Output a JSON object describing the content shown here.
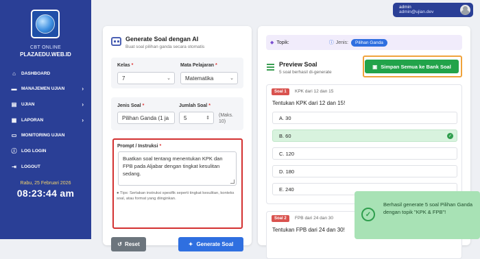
{
  "sidebar": {
    "brand_top": "CBT ONLINE",
    "brand_site": "PLAZAEDU.WEB.ID",
    "items": [
      {
        "label": "DASHBOARD",
        "icon": "home-icon",
        "has_submenu": false
      },
      {
        "label": "MANAJEMEN UJIAN",
        "icon": "folder-icon",
        "has_submenu": true
      },
      {
        "label": "UJIAN",
        "icon": "file-icon",
        "has_submenu": true
      },
      {
        "label": "LAPORAN",
        "icon": "report-icon",
        "has_submenu": true
      },
      {
        "label": "MONITORING UJIAN",
        "icon": "monitor-icon",
        "has_submenu": false
      },
      {
        "label": "LOG LOGIN",
        "icon": "info-icon",
        "has_submenu": false
      },
      {
        "label": "LOGOUT",
        "icon": "logout-icon",
        "has_submenu": false
      }
    ],
    "date": "Rabu, 25 Februari 2026",
    "time": "08:23:44 am"
  },
  "user": {
    "name": "admin",
    "email": "admin@ujian.dev"
  },
  "generator": {
    "title": "Generate Soal dengan AI",
    "subtitle": "Buat soal pilihan ganda secara otomatis",
    "kelas_label": "Kelas",
    "kelas_value": "7",
    "mapel_label": "Mata Pelajaran",
    "mapel_value": "Matematika",
    "jenis_label": "Jenis Soal",
    "jenis_value": "Pilihan Ganda (1 ja",
    "jumlah_label": "Jumlah Soal",
    "jumlah_value": "5",
    "jumlah_note": "(Maks. 10)",
    "prompt_label": "Prompt / Instruksi",
    "prompt_value": "Buatkan soal tentang menentukan KPK dan FPB pada Aljabar dengan tingkat kesulitan sedang.",
    "tips": "Tips: Sertakan instruksi spesifik seperti tingkat kesulitan, konteks soal, atau format yang diinginkan.",
    "reset_label": "Reset",
    "generate_label": "Generate Soal",
    "required_mark": "*"
  },
  "preview": {
    "topik_label": "Topik:",
    "jenis_label": "Jenis:",
    "jenis_value": "Pilihan Ganda",
    "title": "Preview Soal",
    "subtitle": "5 soal berhasil di-generate",
    "save_label": "Simpan Semua ke Bank Soal",
    "questions": [
      {
        "badge": "Soal 1",
        "meta": "KPK dari 12 dan 15",
        "text": "Tentukan KPK dari 12 dan 15!",
        "options": [
          {
            "label": "A.  30",
            "correct": false
          },
          {
            "label": "B.  60",
            "correct": true
          },
          {
            "label": "C.  120",
            "correct": false
          },
          {
            "label": "D.  180",
            "correct": false
          },
          {
            "label": "E.  240",
            "correct": false
          }
        ]
      },
      {
        "badge": "Soal 2",
        "meta": "FPB dari 24 dan 30",
        "text": "Tentukan FPB dari 24 dan 30!"
      }
    ]
  },
  "toast": {
    "message": "Berhasil generate 5 soal Pilihan Ganda dengan topik \"KPK & FPB\"!"
  },
  "colors": {
    "sidebar": "#2a3f96",
    "primary": "#2f6fe0",
    "success": "#22a34a",
    "danger": "#d32f2f",
    "highlight": "#f0a23a"
  }
}
